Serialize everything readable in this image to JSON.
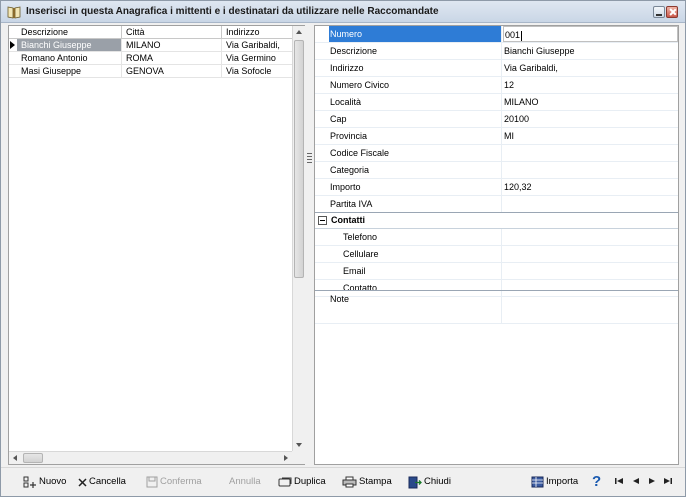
{
  "window": {
    "title": "Inserisci in questa Anagrafica i mittenti e i destinatari da utilizzare nelle Raccomandate"
  },
  "grid": {
    "columns": [
      "Descrizione",
      "Città",
      "Indirizzo"
    ],
    "rows": [
      {
        "descrizione": "Bianchi Giuseppe",
        "citta": "MILANO",
        "indirizzo": "Via Garibaldi,"
      },
      {
        "descrizione": "Romano Antonio",
        "citta": "ROMA",
        "indirizzo": "Via Germino"
      },
      {
        "descrizione": "Masi Giuseppe",
        "citta": "GENOVA",
        "indirizzo": "Via Sofocle"
      }
    ],
    "selected_row": 0
  },
  "properties": {
    "fields": [
      {
        "label": "Numero",
        "value": "001"
      },
      {
        "label": "Descrizione",
        "value": "Bianchi Giuseppe"
      },
      {
        "label": "Indirizzo",
        "value": "Via Garibaldi,"
      },
      {
        "label": "Numero Civico",
        "value": "12"
      },
      {
        "label": "Località",
        "value": "MILANO"
      },
      {
        "label": "Cap",
        "value": "20100"
      },
      {
        "label": "Provincia",
        "value": "MI"
      },
      {
        "label": "Codice Fiscale",
        "value": ""
      },
      {
        "label": "Categoria",
        "value": ""
      },
      {
        "label": "Importo",
        "value": "120,32"
      },
      {
        "label": "Partita IVA",
        "value": ""
      }
    ],
    "category": "Contatti",
    "contatti": [
      {
        "label": "Telefono",
        "value": ""
      },
      {
        "label": "Cellulare",
        "value": ""
      },
      {
        "label": "Email",
        "value": ""
      },
      {
        "label": "Contatto",
        "value": ""
      }
    ],
    "note": {
      "label": "Note",
      "value": ""
    }
  },
  "toolbar": {
    "nuovo": "Nuovo",
    "cancella": "Cancella",
    "conferma": "Conferma",
    "annulla": "Annulla",
    "duplica": "Duplica",
    "stampa": "Stampa",
    "chiudi": "Chiudi",
    "importa": "Importa"
  },
  "colors": {
    "selection": "#2e7cd6",
    "grid_selection": "#9aa0a8"
  }
}
